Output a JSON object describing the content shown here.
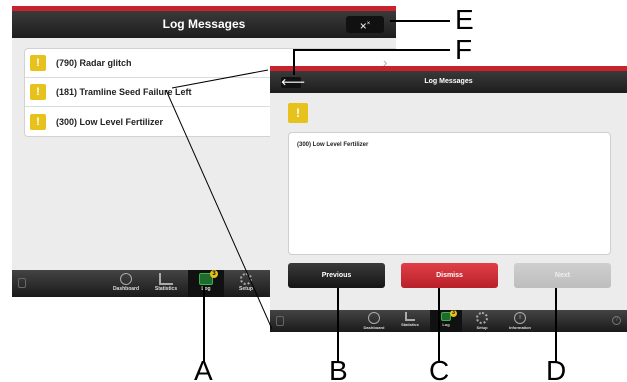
{
  "back_screen": {
    "title": "Log Messages",
    "close_label": "×",
    "messages": [
      {
        "icon": "!",
        "text": "(790) Radar glitch"
      },
      {
        "icon": "!",
        "text": "(181) Tramline Seed Failure Left"
      },
      {
        "icon": "!",
        "text": "(300) Low Level Fertilizer"
      }
    ],
    "tabs": [
      {
        "label": "Dashboard",
        "icon": "gauge-icon"
      },
      {
        "label": "Statistics",
        "icon": "bar-chart-icon"
      },
      {
        "label": "Log",
        "icon": "log-icon",
        "badge": "3"
      },
      {
        "label": "Setup",
        "icon": "gear-icon"
      }
    ]
  },
  "front_screen": {
    "title": "Log Messages",
    "back_label": "🡐",
    "icon": "!",
    "detail_text": "(300) Low Level Fertilizer",
    "buttons": {
      "previous": "Previous",
      "dismiss": "Dismiss",
      "next": "Next"
    },
    "tabs": [
      {
        "label": "Dashboard",
        "icon": "gauge-icon"
      },
      {
        "label": "Statistics",
        "icon": "bar-chart-icon"
      },
      {
        "label": "Log",
        "icon": "log-icon",
        "badge": "3"
      },
      {
        "label": "Setup",
        "icon": "gear-icon"
      },
      {
        "label": "Information",
        "icon": "info-icon"
      }
    ],
    "help_label": "?"
  },
  "callouts": [
    "A",
    "B",
    "C",
    "D",
    "E",
    "F"
  ],
  "colors": {
    "accent_red": "#c8232c",
    "warning_yellow": "#e7c21c",
    "active_green": "#39b34a"
  }
}
